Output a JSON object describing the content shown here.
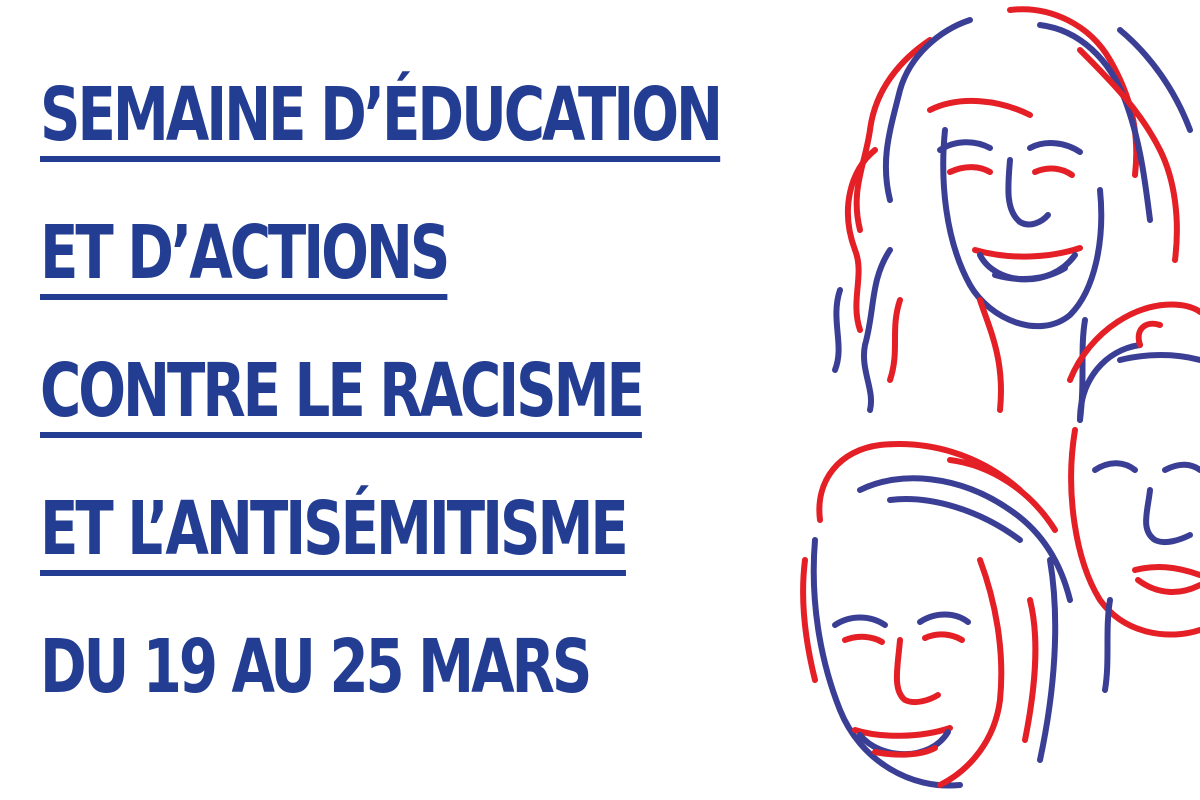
{
  "colors": {
    "blue": "#223d92",
    "red": "#e41f26",
    "line_blue": "#3a3f95",
    "background": "#ffffff"
  },
  "title": {
    "lines": [
      "SEMAINE D’ÉDUCATION",
      "ET D’ACTIONS",
      "CONTRE LE RACISME",
      "ET L’ANTISÉMITISME"
    ],
    "dates": "DU 19 AU 25 MARS"
  },
  "illustration": {
    "icon": "three-faces-line-drawing-icon"
  }
}
